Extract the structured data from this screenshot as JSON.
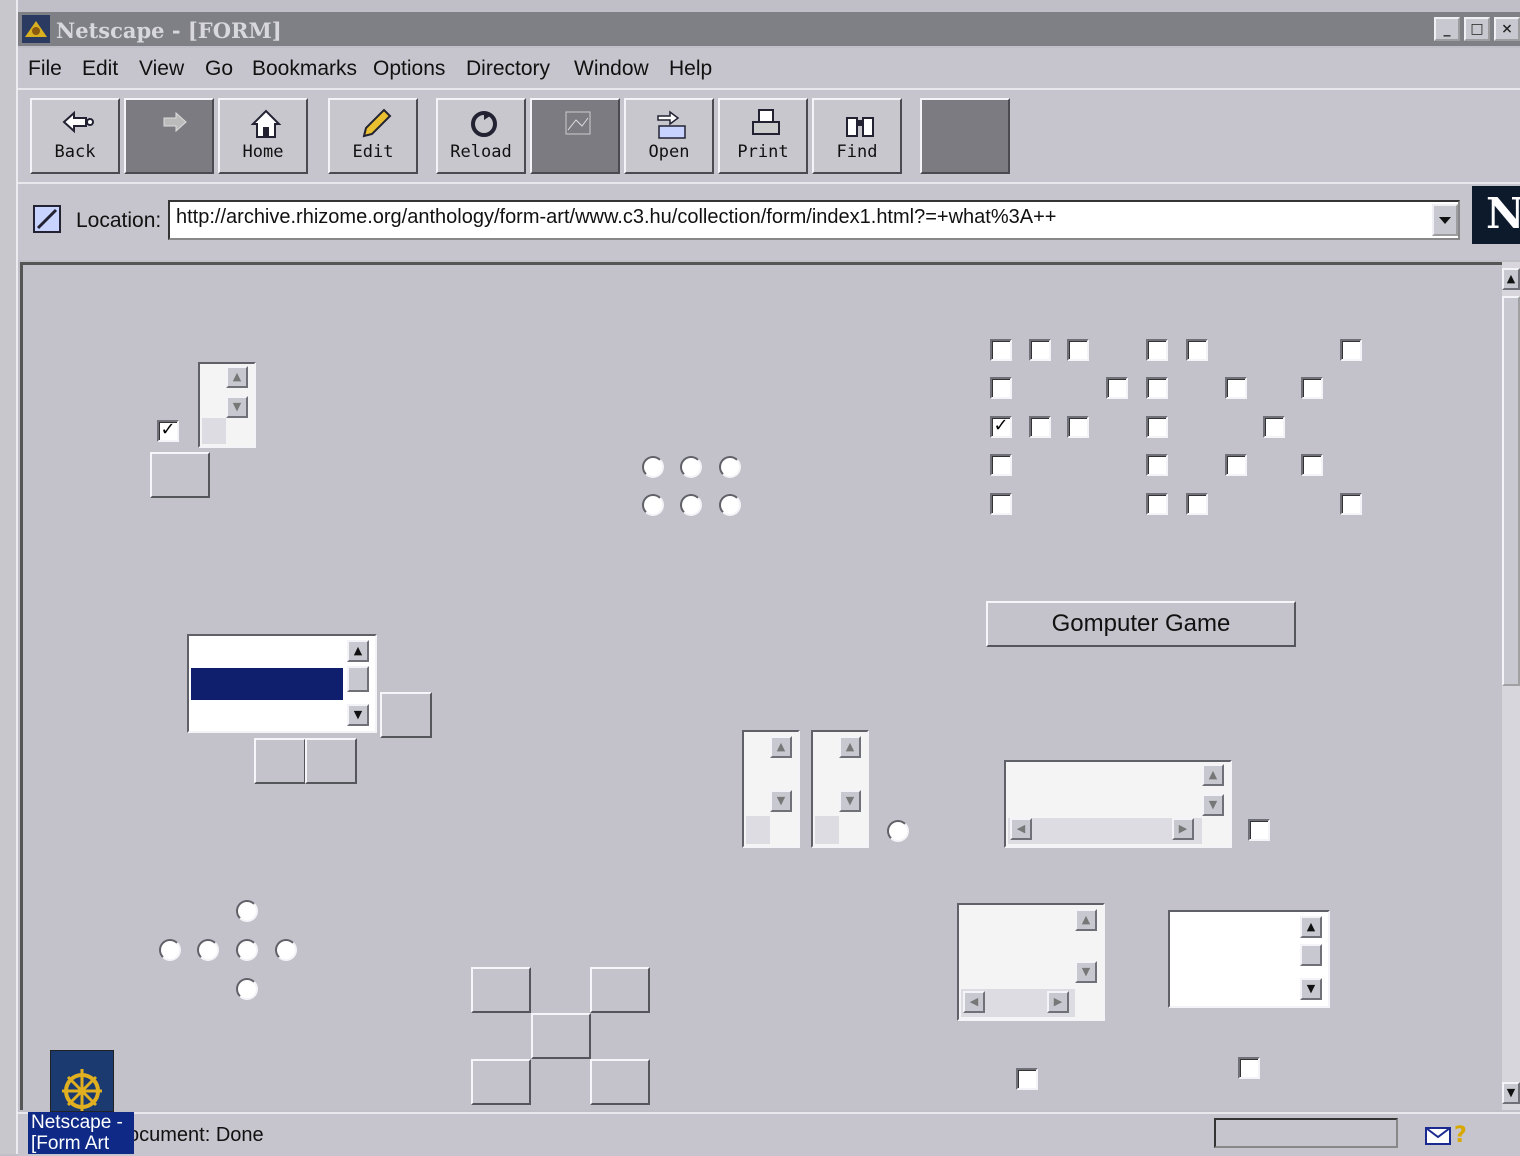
{
  "window": {
    "title": "Netscape - [FORM]",
    "controls": [
      "_",
      "□",
      "×"
    ]
  },
  "menu": [
    "File",
    "Edit",
    "View",
    "Go",
    "Bookmarks",
    "Options",
    "Directory",
    "Window",
    "Help"
  ],
  "toolbar": {
    "back": "Back",
    "home": "Home",
    "edit": "Edit",
    "reload": "Reload",
    "open": "Open",
    "print": "Print",
    "find": "Find"
  },
  "location": {
    "label": "Location:",
    "url": "http://archive.rhizome.org/anthology/form-art/www.c3.hu/collection/form/index1.html?=+what%3A++"
  },
  "logo": "N",
  "form": {
    "button_label": "Gomputer Game"
  },
  "status": {
    "text": "ocument: Done",
    "taskbar_label": "Netscape - [Form Art"
  },
  "colors": {
    "background": "#c3c2ca",
    "selection": "#0f1f6e"
  }
}
